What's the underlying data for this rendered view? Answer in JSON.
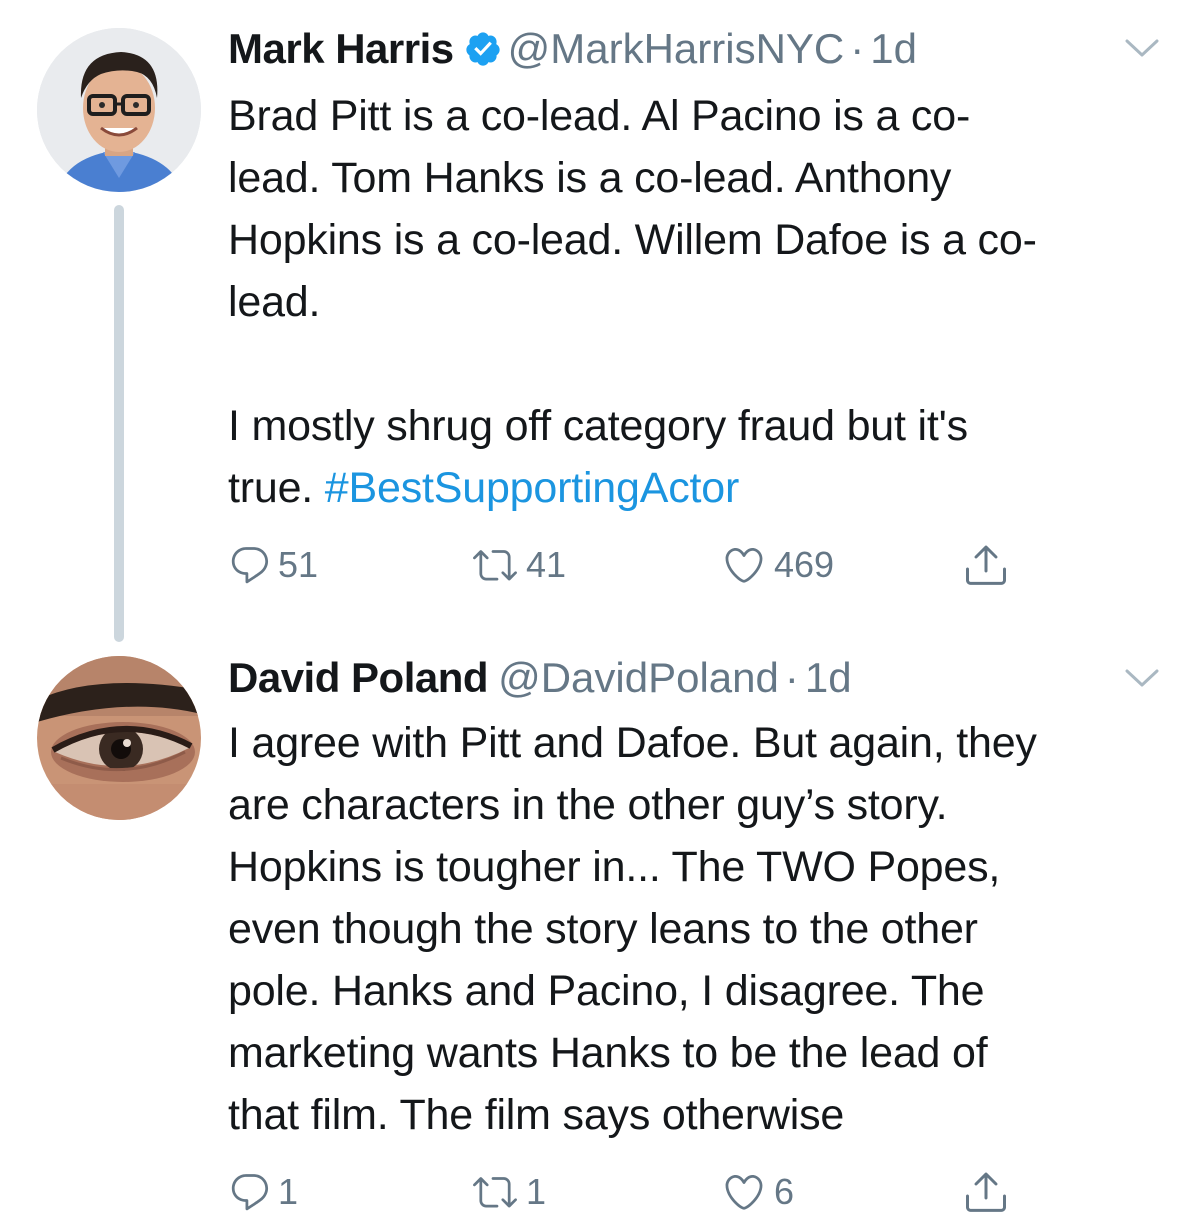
{
  "tweets": [
    {
      "author": {
        "display_name": "Mark Harris",
        "handle": "@MarkHarrisNYC",
        "verified": true,
        "avatar_icon": "person-with-glasses-avatar"
      },
      "separator": "·",
      "time": "1d",
      "text_main": "Brad Pitt is a co-lead. Al Pacino is a co-\nlead. Tom Hanks is a co-lead. Anthony\nHopkins is a co-lead. Willem Dafoe is a co-\nlead.\n\nI mostly shrug off category fraud but it's\ntrue. ",
      "hashtag": "#BestSupportingActor",
      "actions": {
        "replies": "51",
        "retweets": "41",
        "likes": "469"
      }
    },
    {
      "author": {
        "display_name": "David Poland",
        "handle": "@DavidPoland",
        "verified": false,
        "avatar_icon": "eye-closeup-avatar"
      },
      "separator": "·",
      "time": "1d",
      "text_main": "I agree with Pitt and Dafoe. But again, they\nare characters in the other guy’s story.\nHopkins is tougher in... The TWO Popes,\neven though the story leans to the other\npole. Hanks and Pacino, I disagree. The\nmarketing wants Hanks to be the lead of\nthat film. The film says otherwise",
      "actions": {
        "replies": "1",
        "retweets": "1",
        "likes": "6"
      }
    }
  ],
  "colors": {
    "text": "#14171a",
    "secondary": "#657786",
    "link": "#1b95e0",
    "verified": "#1da1f2",
    "thread_line": "#ccd6dd"
  },
  "icons": [
    "verified-badge-icon",
    "chevron-down-icon",
    "reply-icon",
    "retweet-icon",
    "like-icon",
    "share-icon"
  ]
}
